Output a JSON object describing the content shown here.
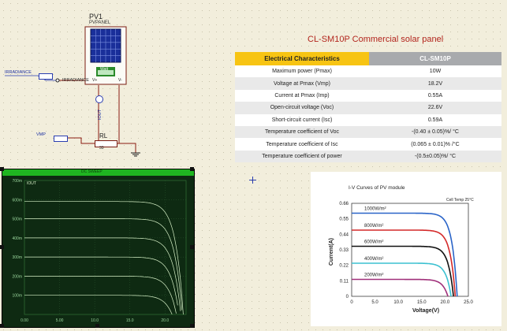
{
  "schematic": {
    "pv_ref": "PV1",
    "pv_type": "PVPANEL",
    "pv_readout_label": "Watt",
    "pv_pin_left": "V+",
    "pv_pin_right": "V-",
    "irradiance_terminal": "IRRADIANCE",
    "irradiance_pin": "IRRADIANCE",
    "vmp_terminal": "VMP",
    "iout_label": "IOUT",
    "resistor_ref": "RL",
    "resistor_value": "33"
  },
  "spec_table": {
    "title": "CL-SM10P Commercial solar panel",
    "header_left": "Electrical Characteristics",
    "header_right": "CL-SM10P",
    "rows": [
      {
        "label": "Maximum power (Pmax)",
        "value": "10W"
      },
      {
        "label": "Voltage at Pmax (Vmp)",
        "value": "18.2V"
      },
      {
        "label": "Current at Pmax (Imp)",
        "value": "0.55A"
      },
      {
        "label": "Open-circuit voltage (Voc)",
        "value": "22.6V"
      },
      {
        "label": "Short-circuit current (Isc)",
        "value": "0.59A"
      },
      {
        "label": "Temperature coefficient of Voc",
        "value": "-(0.40 ± 0.05)%/ °C"
      },
      {
        "label": "Temperature coefficient of Isc",
        "value": "(0.065 ± 0.01)% /°C"
      },
      {
        "label": "Temperature coefficient of power",
        "value": "-(0.5±0.05)%/ °C"
      }
    ]
  },
  "dc_sweep_graph": {
    "title": "DC SWEEP",
    "trace_label": "IOUT",
    "y_ticks": [
      "700m",
      "600m",
      "500m",
      "400m",
      "300m",
      "200m",
      "100m"
    ],
    "x_ticks": [
      "0.00",
      "5.00",
      "10.0",
      "15.0",
      "20.0"
    ],
    "curves_isc": [
      0.59,
      0.5,
      0.4,
      0.3,
      0.2,
      0.1
    ],
    "ymax": 0.7,
    "xmax": 23
  },
  "iv_card": {
    "title": "I-V Curves of PV module",
    "cell_temp": "Cell Temp 25°C",
    "ylabel": "Current(A)",
    "xlabel": "Voltage(V)",
    "y_ticks": [
      "0.66",
      "0.55",
      "0.44",
      "0.33",
      "0.22",
      "0.11",
      "0"
    ],
    "x_ticks": [
      "0",
      "5.0",
      "10.0",
      "15.0",
      "20.0",
      "25.0"
    ],
    "series": [
      {
        "name": "1000W/m²",
        "isc": 0.59,
        "voc": 22.6,
        "color": "#2a64c8"
      },
      {
        "name": "800W/m²",
        "isc": 0.47,
        "voc": 22.2,
        "color": "#d42a2a"
      },
      {
        "name": "600W/m²",
        "isc": 0.355,
        "voc": 21.8,
        "color": "#111111"
      },
      {
        "name": "400W/m²",
        "isc": 0.235,
        "voc": 21.3,
        "color": "#3cc1d1"
      },
      {
        "name": "200W/m²",
        "isc": 0.12,
        "voc": 20.6,
        "color": "#a0307a"
      }
    ]
  },
  "colors": {
    "accent_header": "#f7c413",
    "graph_green": "#1fb521",
    "title_red": "#b3261e"
  }
}
